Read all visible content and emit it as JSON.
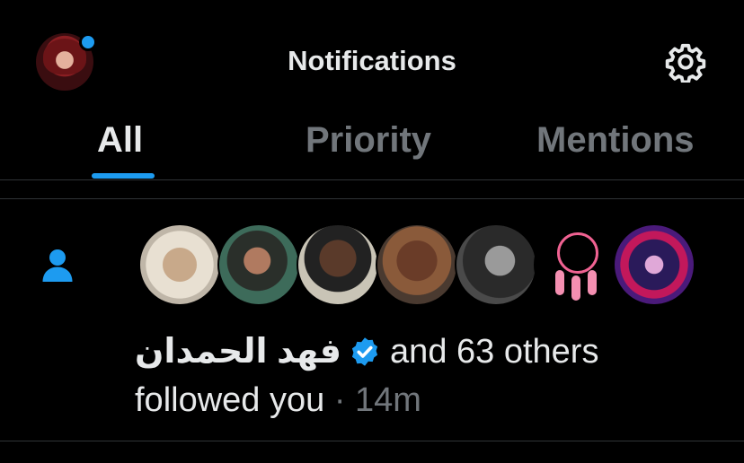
{
  "header": {
    "title": "Notifications",
    "avatar_icon": "user-avatar",
    "settings_icon": "gear-icon"
  },
  "tabs": [
    {
      "label": "All",
      "active": true
    },
    {
      "label": "Priority",
      "active": false
    },
    {
      "label": "Mentions",
      "active": false
    }
  ],
  "notification": {
    "type_icon": "person-icon",
    "avatar_count_shown": 7,
    "name": "فهد الحمدان",
    "verified": true,
    "others_text": "and 63 others",
    "action": "followed you",
    "separator": "·",
    "time": "14m"
  },
  "colors": {
    "background": "#000000",
    "accent": "#1d9bf0",
    "text": "#e7e9ea",
    "muted": "#71767b",
    "divider": "#2f3336"
  }
}
